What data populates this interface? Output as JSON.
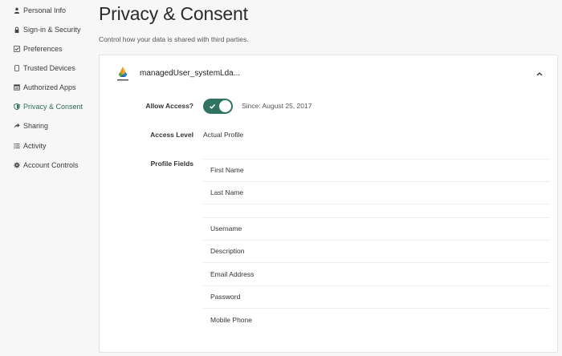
{
  "sidebar": {
    "items": [
      {
        "label": "Personal Info",
        "icon": "person-icon"
      },
      {
        "label": "Sign-in & Security",
        "icon": "lock-icon"
      },
      {
        "label": "Preferences",
        "icon": "checkbox-icon"
      },
      {
        "label": "Trusted Devices",
        "icon": "device-icon"
      },
      {
        "label": "Authorized Apps",
        "icon": "apps-icon"
      },
      {
        "label": "Privacy & Consent",
        "icon": "shield-icon",
        "active": true
      },
      {
        "label": "Sharing",
        "icon": "share-icon"
      },
      {
        "label": "Activity",
        "icon": "list-icon"
      },
      {
        "label": "Account Controls",
        "icon": "gear-icon"
      }
    ]
  },
  "main": {
    "title": "Privacy & Consent",
    "subtitle": "Control how your data is shared with third parties."
  },
  "card": {
    "app_name": "managedUser_systemLda...",
    "allow_access_label": "Allow Access?",
    "allow_access_on": true,
    "since": "Since: August 25, 2017",
    "access_level_label": "Access Level",
    "access_level_value": "Actual Profile",
    "profile_fields_label": "Profile Fields",
    "field_group_1": [
      "First Name",
      "Last Name"
    ],
    "field_group_2": [
      "Username",
      "Description",
      "Email Address",
      "Password",
      "Mobile Phone"
    ]
  },
  "colors": {
    "accent": "#2f7360",
    "active_nav": "#2e6b57"
  }
}
